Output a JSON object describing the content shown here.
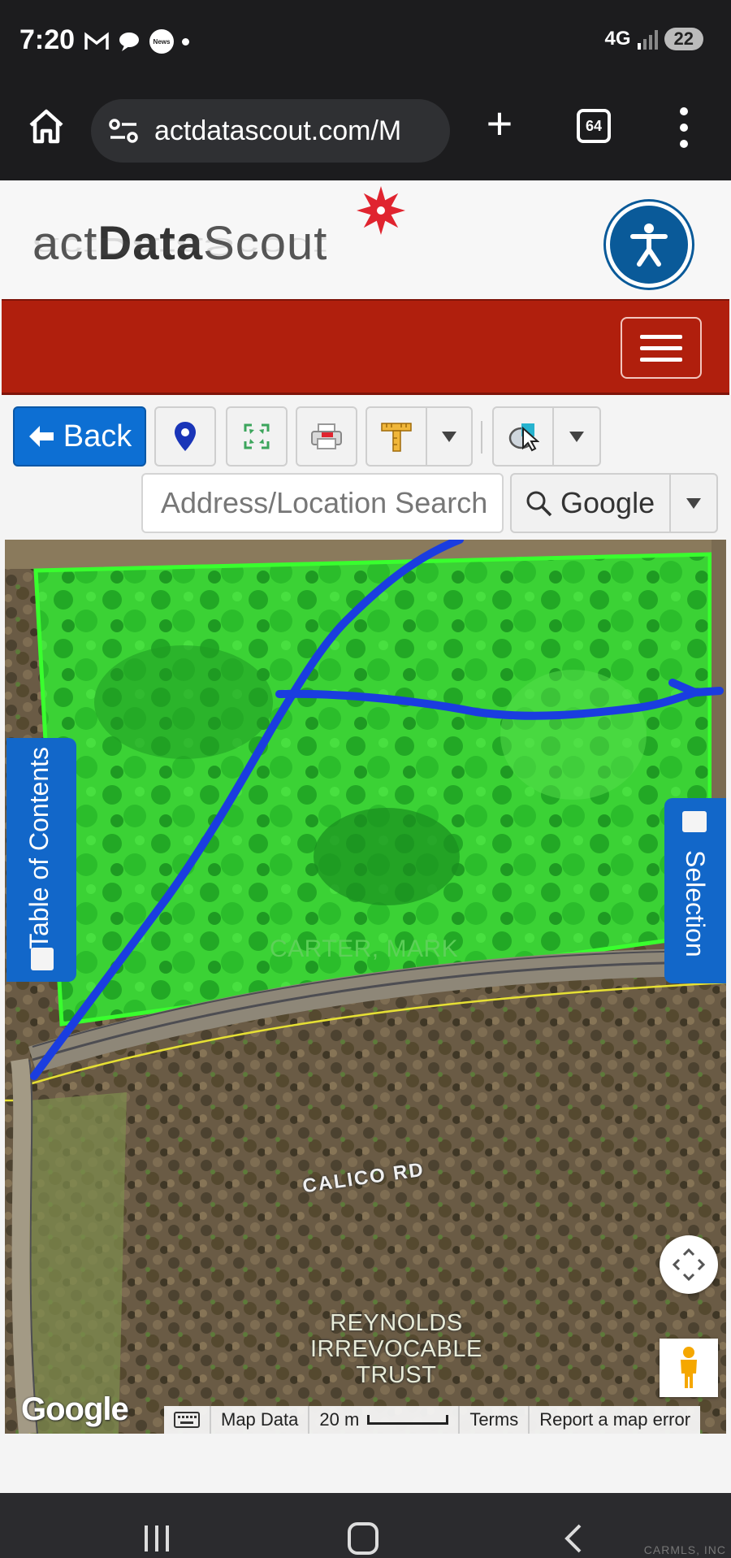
{
  "status_bar": {
    "time": "7:20",
    "network": "4G",
    "battery": "22",
    "notification_icons": [
      "gmail-icon",
      "chat-bubble-icon",
      "news-icon",
      "dot-icon"
    ],
    "news_label": "News"
  },
  "browser": {
    "url": "actdatascout.com/M",
    "tab_count": "64"
  },
  "site": {
    "logo_text_light": "act",
    "logo_text_bold": "Data",
    "logo_text_end": "Scout",
    "brand_red": "#b01f0d",
    "accent_blue": "#1267c9"
  },
  "toolbar": {
    "back_label": "Back",
    "search_placeholder": "Address/Location Search",
    "search_provider": "Google",
    "buttons": [
      "location-pin-icon",
      "full-extent-icon",
      "print-icon",
      "measure-ruler-icon",
      "select-tool-icon"
    ]
  },
  "map": {
    "parcel_owner": "CARTER, MARK",
    "road_name": "CALICO RD",
    "parcel_2_line1": "REYNOLDS",
    "parcel_2_line2": "IRREVOCABLE",
    "parcel_2_line3": "TRUST",
    "toc_label": "Table of Contents",
    "selection_label": "Selection",
    "google_logo": "Google",
    "map_data_label": "Map Data",
    "scale_label": "20 m",
    "terms_label": "Terms",
    "report_label": "Report a map error",
    "parcel_highlight_color": "#39ff2e",
    "drawn_line_color": "#1a3de0"
  },
  "footer": {
    "watermark": "CARMLS, INC"
  }
}
